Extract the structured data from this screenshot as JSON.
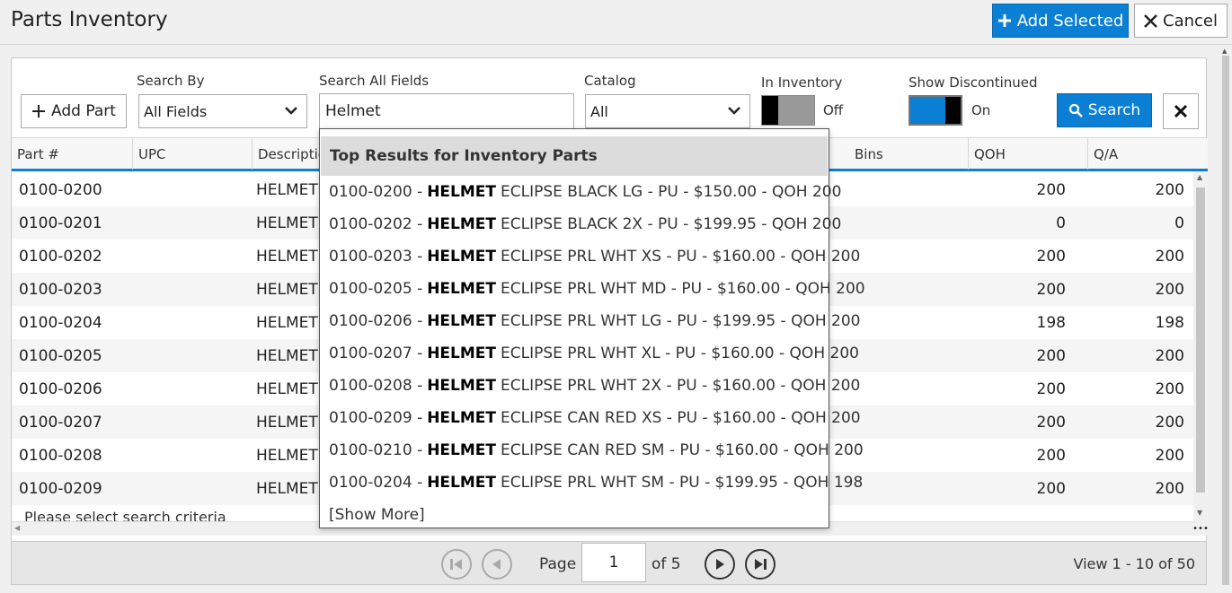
{
  "header": {
    "title": "Parts Inventory",
    "add_selected_label": "Add Selected",
    "cancel_label": "Cancel"
  },
  "filters": {
    "add_part_label": "Add Part",
    "search_by_label": "Search By",
    "search_by_value": "All Fields",
    "search_all_label": "Search All Fields",
    "search_all_value": "Helmet",
    "catalog_label": "Catalog",
    "catalog_value": "All",
    "in_inventory_label": "In Inventory",
    "in_inventory_state": "Off",
    "show_discontinued_label": "Show Discontinued",
    "show_discontinued_state": "On",
    "search_button_label": "Search"
  },
  "grid": {
    "columns": [
      "Part #",
      "UPC",
      "Description",
      "Bins",
      "QOH",
      "Q/A"
    ],
    "rows": [
      {
        "part": "0100-0200",
        "desc": "HELMET E",
        "qoh": "200",
        "qa": "200"
      },
      {
        "part": "0100-0201",
        "desc": "HELMET E",
        "qoh": "0",
        "qa": "0"
      },
      {
        "part": "0100-0202",
        "desc": "HELMET E",
        "qoh": "200",
        "qa": "200"
      },
      {
        "part": "0100-0203",
        "desc": "HELMET E",
        "qoh": "200",
        "qa": "200"
      },
      {
        "part": "0100-0204",
        "desc": "HELMET E",
        "qoh": "198",
        "qa": "198"
      },
      {
        "part": "0100-0205",
        "desc": "HELMET E",
        "qoh": "200",
        "qa": "200"
      },
      {
        "part": "0100-0206",
        "desc": "HELMET E",
        "qoh": "200",
        "qa": "200"
      },
      {
        "part": "0100-0207",
        "desc": "HELMET E",
        "qoh": "200",
        "qa": "200"
      },
      {
        "part": "0100-0208",
        "desc": "HELMET E",
        "qoh": "200",
        "qa": "200"
      },
      {
        "part": "0100-0209",
        "desc": "HELMET E",
        "qoh": "200",
        "qa": "200"
      }
    ],
    "status_text": "Please select search criteria"
  },
  "pager": {
    "page_label": "Page",
    "page_value": "1",
    "of_label": "of 5",
    "view_count": "View 1 - 10 of 50"
  },
  "dropdown": {
    "header": "Top Results for Inventory Parts",
    "items": [
      {
        "part": "0100-0200 -",
        "keyword": "HELMET",
        "rest": "ECLIPSE BLACK LG - PU - $150.00 - QOH 200"
      },
      {
        "part": "0100-0202 -",
        "keyword": "HELMET",
        "rest": "ECLIPSE BLACK 2X - PU - $199.95 - QOH 200"
      },
      {
        "part": "0100-0203 -",
        "keyword": "HELMET",
        "rest": "ECLIPSE PRL WHT XS - PU - $160.00 - QOH 200"
      },
      {
        "part": "0100-0205 -",
        "keyword": "HELMET",
        "rest": "ECLIPSE PRL WHT MD - PU - $160.00 - QOH 200"
      },
      {
        "part": "0100-0206 -",
        "keyword": "HELMET",
        "rest": "ECLIPSE PRL WHT LG - PU - $199.95 - QOH 200"
      },
      {
        "part": "0100-0207 -",
        "keyword": "HELMET",
        "rest": "ECLIPSE PRL WHT XL - PU - $160.00 - QOH 200"
      },
      {
        "part": "0100-0208 -",
        "keyword": "HELMET",
        "rest": "ECLIPSE PRL WHT 2X - PU - $160.00 - QOH 200"
      },
      {
        "part": "0100-0209 -",
        "keyword": "HELMET",
        "rest": "ECLIPSE CAN RED XS - PU - $160.00 - QOH 200"
      },
      {
        "part": "0100-0210 -",
        "keyword": "HELMET",
        "rest": "ECLIPSE CAN RED SM - PU - $160.00 - QOH 200"
      },
      {
        "part": "0100-0204 -",
        "keyword": "HELMET",
        "rest": "ECLIPSE PRL WHT SM - PU - $199.95 - QOH 198"
      }
    ],
    "show_more": "[Show More]"
  },
  "colors": {
    "accent": "#0a7fd4",
    "toggle_off_track": "#999999"
  },
  "icons": {
    "add": "plus-icon",
    "cancel": "close-icon",
    "search": "search-icon",
    "clear": "close-icon",
    "chevron": "chevron-down-icon",
    "pager": [
      "first-page-icon",
      "prev-page-icon",
      "next-page-icon",
      "last-page-icon"
    ]
  }
}
